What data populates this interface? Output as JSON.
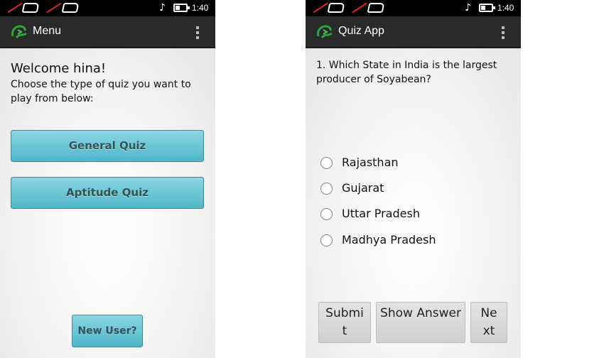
{
  "status_bar": {
    "time": "1:40",
    "note_icon": "music-note-muted-icon"
  },
  "menu_screen": {
    "title": "Menu",
    "welcome": "Welcome hina!",
    "instruction": "Choose the type of quiz you want to play from below:",
    "buttons": {
      "general": "General Quiz",
      "aptitude": "Aptitude Quiz",
      "new_user": "New User?"
    }
  },
  "quiz_screen": {
    "title": "Quiz App",
    "question": "1. Which State in India is the largest producer of Soyabean?",
    "options": [
      "Rajasthan",
      "Gujarat",
      "Uttar Pradesh",
      "Madhya Pradesh"
    ],
    "buttons": {
      "submit": "Submit",
      "show_answer": "Show Answer",
      "next": "Next"
    }
  },
  "colors": {
    "status_bar": "#000000",
    "action_bar": "#2a2a2a",
    "quiz_button": "#6cc6d6",
    "action_button": "#d9d9d9",
    "logo": "#2fa23f"
  }
}
